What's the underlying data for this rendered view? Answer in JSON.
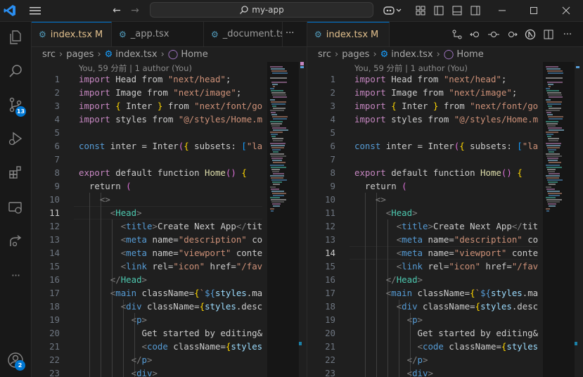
{
  "title_bar": {
    "search_text": "my-app",
    "search_icon": "search-icon",
    "copilot_icon": "copilot-icon"
  },
  "activity_bar": {
    "items": [
      {
        "name": "explorer-icon"
      },
      {
        "name": "search-icon"
      },
      {
        "name": "source-control-icon",
        "badge": "13"
      },
      {
        "name": "run-debug-icon"
      },
      {
        "name": "extensions-icon"
      },
      {
        "name": "remote-explorer-icon"
      },
      {
        "name": "live-share-icon"
      },
      {
        "name": "more-icon",
        "label": "···"
      }
    ],
    "accounts_badge": "2"
  },
  "left_editor": {
    "tabs": [
      {
        "label": "index.tsx",
        "modified": "M"
      },
      {
        "label": "_app.tsx"
      },
      {
        "label": "_document.ts"
      }
    ],
    "tabs_more": "···",
    "breadcrumbs": [
      "src",
      "pages",
      "index.tsx",
      "Home"
    ],
    "blame": "You, 59 分前 | 1 author (You)",
    "active_line": 11
  },
  "right_editor": {
    "tabs": [
      {
        "label": "index.tsx",
        "modified": "M"
      }
    ],
    "breadcrumbs": [
      "src",
      "pages",
      "index.tsx",
      "Home"
    ],
    "blame": "You, 59 分前 | 1 author (You)",
    "active_line": 14
  },
  "code_lines": [
    {
      "n": "1",
      "t": "import Head from \"next/head\";"
    },
    {
      "n": "2",
      "t": "import Image from \"next/image\";"
    },
    {
      "n": "3",
      "t": "import { Inter } from \"next/font/go"
    },
    {
      "n": "4",
      "t": "import styles from \"@/styles/Home.m"
    },
    {
      "n": "5",
      "t": ""
    },
    {
      "n": "6",
      "t": "const inter = Inter({ subsets: [\"la"
    },
    {
      "n": "7",
      "t": ""
    },
    {
      "n": "8",
      "t": "export default function Home() {"
    },
    {
      "n": "9",
      "t": "  return ("
    },
    {
      "n": "10",
      "t": "    <>"
    },
    {
      "n": "11",
      "t": "      <Head>"
    },
    {
      "n": "12",
      "t": "        <title>Create Next App</tit"
    },
    {
      "n": "13",
      "t": "        <meta name=\"description\" co"
    },
    {
      "n": "14",
      "t": "        <meta name=\"viewport\" conte"
    },
    {
      "n": "15",
      "t": "        <link rel=\"icon\" href=\"/fav"
    },
    {
      "n": "16",
      "t": "      </Head>"
    },
    {
      "n": "17",
      "t": "      <main className={`${styles.ma"
    },
    {
      "n": "18",
      "t": "        <div className={styles.desc"
    },
    {
      "n": "19",
      "t": "          <p>"
    },
    {
      "n": "20",
      "t": "            Get started by editing&"
    },
    {
      "n": "21",
      "t": "            <code className={styles"
    },
    {
      "n": "22",
      "t": "          </p>"
    },
    {
      "n": "23",
      "t": "          <div>"
    }
  ],
  "colors": {
    "accent": "#0078d4",
    "keyword": "#c586c0",
    "string": "#ce9178",
    "tag": "#569cd6",
    "component": "#4ec9b0"
  }
}
